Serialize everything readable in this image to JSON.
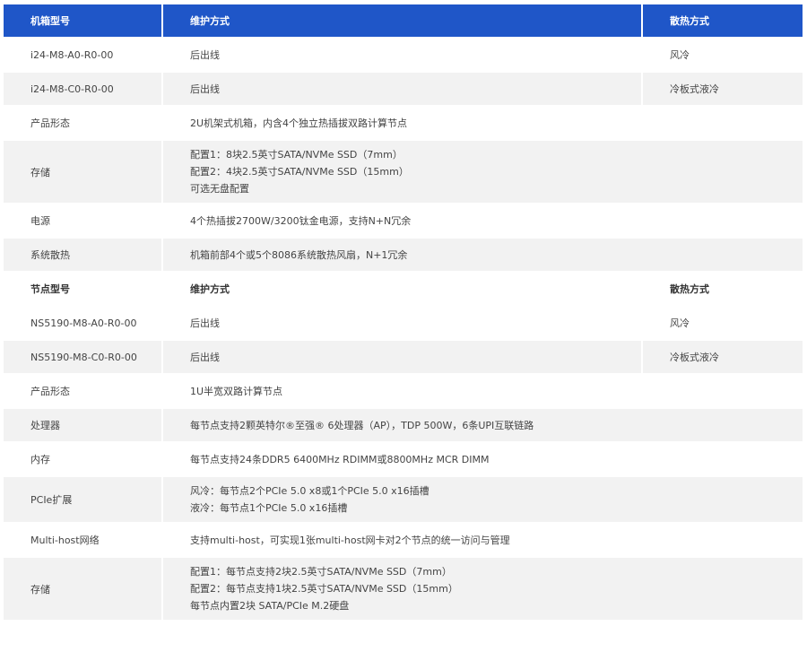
{
  "chassis_header": [
    "机箱型号",
    "维护方式",
    "散热方式"
  ],
  "chassis_rows": [
    {
      "label": "i24-M8-A0-R0-00",
      "value": "后出线",
      "cooling": "风冷"
    },
    {
      "label": "i24-M8-C0-R0-00",
      "value": "后出线",
      "cooling": "冷板式液冷"
    }
  ],
  "chassis_specs": [
    {
      "label": "产品形态",
      "lines": [
        "2U机架式机箱，内含4个独立热插拔双路计算节点"
      ]
    },
    {
      "label": "存储",
      "lines": [
        "配置1：8块2.5英寸SATA/NVMe SSD（7mm）",
        "配置2：4块2.5英寸SATA/NVMe SSD（15mm）",
        "可选无盘配置"
      ]
    },
    {
      "label": "电源",
      "lines": [
        "4个热插拔2700W/3200钛金电源，支持N+N冗余"
      ]
    },
    {
      "label": "系统散热",
      "lines": [
        "机箱前部4个或5个8086系统散热风扇，N+1冗余"
      ]
    }
  ],
  "node_header": [
    "节点型号",
    "维护方式",
    "散热方式"
  ],
  "node_rows": [
    {
      "label": "NS5190-M8-A0-R0-00",
      "value": "后出线",
      "cooling": "风冷"
    },
    {
      "label": "NS5190-M8-C0-R0-00",
      "value": "后出线",
      "cooling": "冷板式液冷"
    }
  ],
  "node_specs": [
    {
      "label": "产品形态",
      "lines": [
        "1U半宽双路计算节点"
      ]
    },
    {
      "label": "处理器",
      "lines": [
        "每节点支持2颗英特尔®至强® 6处理器（AP），TDP 500W，6条UPI互联链路"
      ]
    },
    {
      "label": "内存",
      "lines": [
        "每节点支持24条DDR5 6400MHz RDIMM或8800MHz MCR DIMM"
      ]
    },
    {
      "label": "PCIe扩展",
      "lines": [
        "风冷：每节点2个PCIe 5.0 x8或1个PCIe 5.0 x16插槽",
        "液冷：每节点1个PCIe 5.0 x16插槽"
      ]
    },
    {
      "label": "Multi-host网络",
      "lines": [
        "支持multi-host，可实现1张multi-host网卡对2个节点的统一访问与管理"
      ]
    },
    {
      "label": "存储",
      "lines": [
        "配置1：每节点支持2块2.5英寸SATA/NVMe SSD（7mm）",
        "配置2：每节点支持1块2.5英寸SATA/NVMe SSD（15mm）",
        "每节点内置2块 SATA/PCIe M.2硬盘"
      ]
    }
  ]
}
